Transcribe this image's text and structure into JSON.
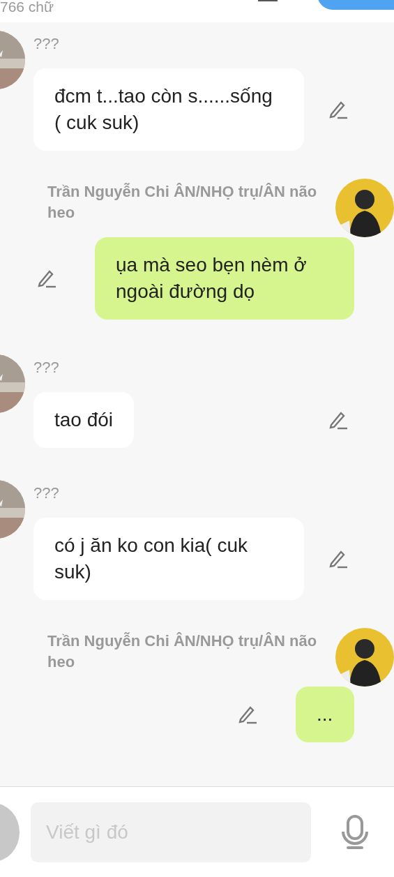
{
  "header": {
    "word_count": "766 chữ"
  },
  "messages": [
    {
      "kind": "incoming",
      "sender": "???",
      "text": "đcm t...tao còn s......sống  ( cuk suk)"
    },
    {
      "kind": "outgoing",
      "sender": "Trần Nguyễn Chi ÂN/NHỌ trụ/ÂN não heo",
      "text": "ụa mà seo bẹn nèm ở ngoài đường dọ"
    },
    {
      "kind": "incoming",
      "sender": "???",
      "text": "tao đói"
    },
    {
      "kind": "incoming",
      "sender": "???",
      "text": "có j ăn ko con kia( cuk suk)"
    },
    {
      "kind": "outgoing",
      "sender": "Trần Nguyễn Chi ÂN/NHỌ trụ/ÂN não heo",
      "text": "..."
    }
  ],
  "composer": {
    "placeholder": "Viết gì đó"
  }
}
